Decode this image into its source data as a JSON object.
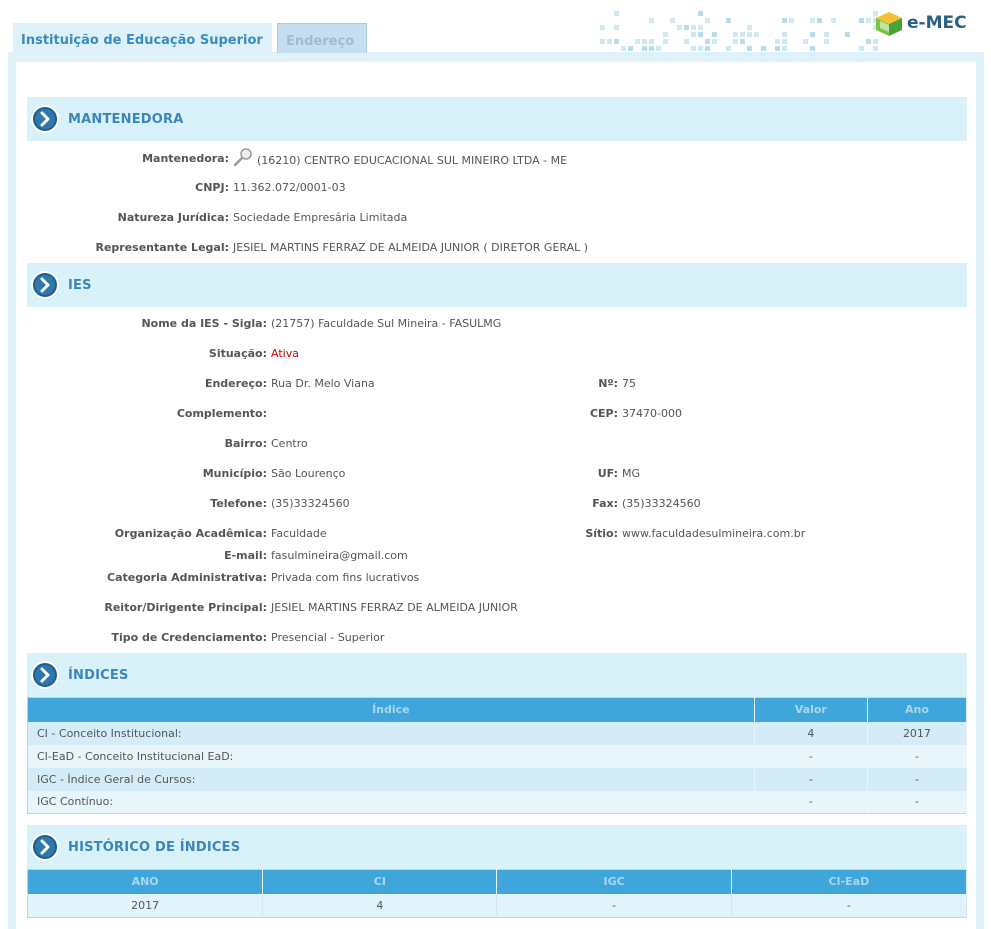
{
  "header": {
    "tabs": [
      {
        "label": "Instituição de Educação Superior",
        "active": true
      },
      {
        "label": "Endereço",
        "active": false
      }
    ],
    "logo_text": "e-MEC"
  },
  "mantenedora": {
    "title": "MANTENEDORA",
    "fields": {
      "mantenedora": {
        "label": "Mantenedora:",
        "value": "(16210) CENTRO EDUCACIONAL SUL MINEIRO LTDA - ME"
      },
      "cnpj": {
        "label": "CNPJ:",
        "value": "11.362.072/0001-03"
      },
      "natureza": {
        "label": "Natureza Jurídica:",
        "value": "Sociedade Empresária Limitada"
      },
      "representante": {
        "label": "Representante Legal:",
        "value": "JESIEL MARTINS FERRAZ DE ALMEIDA JUNIOR ( DIRETOR GERAL )"
      }
    }
  },
  "ies": {
    "title": "IES",
    "fields": {
      "nome": {
        "label": "Nome da IES - Sigla:",
        "value": "(21757) Faculdade Sul Mineira - FASULMG"
      },
      "situacao": {
        "label": "Situação:",
        "value": "Ativa"
      },
      "endereco": {
        "label": "Endereço:",
        "value": "Rua Dr. Melo Viana"
      },
      "numero": {
        "label": "Nº:",
        "value": "75"
      },
      "complemento": {
        "label": "Complemento:",
        "value": ""
      },
      "cep": {
        "label": "CEP:",
        "value": "37470-000"
      },
      "bairro": {
        "label": "Bairro:",
        "value": "Centro"
      },
      "municipio": {
        "label": "Município:",
        "value": "São Lourenço"
      },
      "uf": {
        "label": "UF:",
        "value": "MG"
      },
      "telefone": {
        "label": "Telefone:",
        "value": "(35)33324560"
      },
      "fax": {
        "label": "Fax:",
        "value": "(35)33324560"
      },
      "organizacao": {
        "label": "Organização Acadêmica:",
        "value": "Faculdade"
      },
      "sitio": {
        "label": "Sítio:",
        "value": "www.faculdadesulmineira.com.br"
      },
      "email": {
        "label": "E-mail:",
        "value": "fasulmineira@gmail.com"
      },
      "categoria": {
        "label": "Categoria Administrativa:",
        "value": "Privada com fins lucrativos"
      },
      "reitor": {
        "label": "Reitor/Dirigente Principal:",
        "value": "JESIEL MARTINS FERRAZ DE ALMEIDA JUNIOR"
      },
      "credenciamento": {
        "label": "Tipo de Credenciamento:",
        "value": "Presencial - Superior"
      }
    }
  },
  "indices": {
    "title": "ÍNDICES",
    "columns": [
      "Índice",
      "Valor",
      "Ano"
    ],
    "rows": [
      [
        "CI - Conceito Institucional:",
        "4",
        "2017"
      ],
      [
        "CI-EaD - Conceito Institucional EaD:",
        "-",
        "-"
      ],
      [
        "IGC - Índice Geral de Cursos:",
        "-",
        "-"
      ],
      [
        "IGC Contínuo:",
        "-",
        "-"
      ]
    ]
  },
  "historico": {
    "title": "HISTÓRICO DE ÍNDICES",
    "columns": [
      "ANO",
      "CI",
      "IGC",
      "CI-EaD"
    ],
    "rows": [
      [
        "2017",
        "4",
        "-",
        "-"
      ]
    ]
  },
  "colors": {
    "accent": "#3a86bd",
    "section_bg": "#d9f1f8",
    "table_header": "#3fa6dc",
    "status_active": "#d40000"
  }
}
